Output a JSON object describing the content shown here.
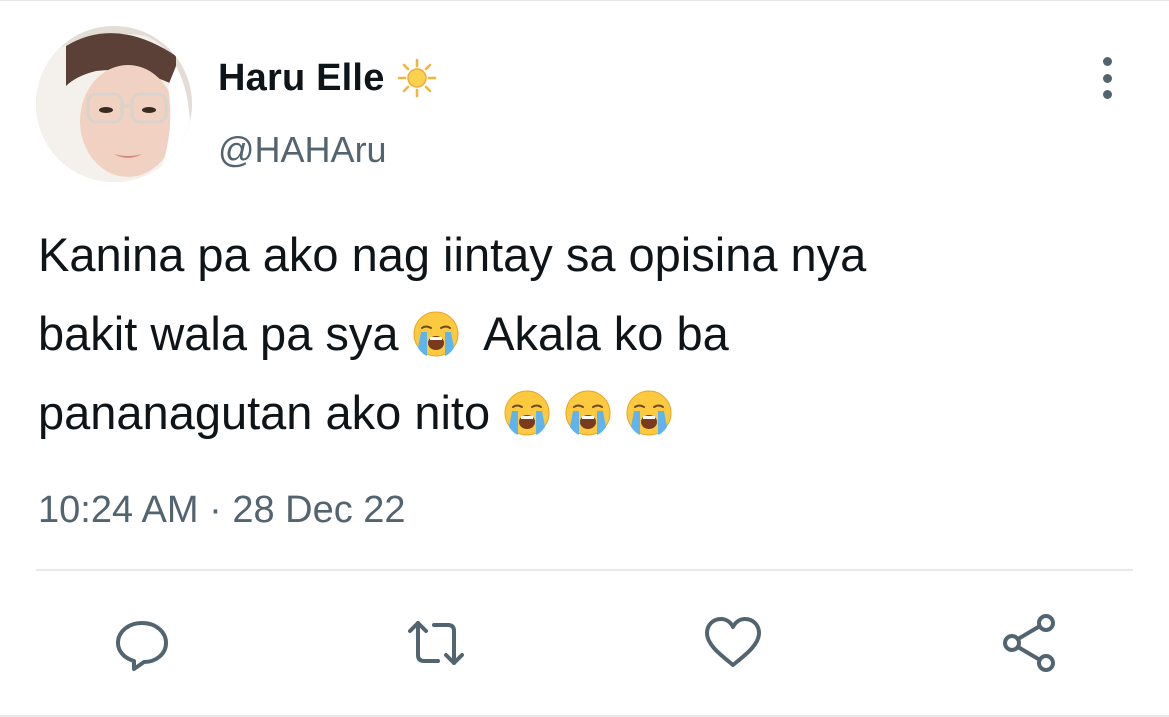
{
  "tweet": {
    "author": {
      "display_name": "Haru Elle",
      "badge_icon": "sun-icon",
      "handle": "@HAHAru",
      "avatar_icon": "profile-photo"
    },
    "text_lines": [
      "Kanina pa ako nag iintay sa opisina nya",
      "bakit wala pa sya",
      "Akala ko ba",
      "pananagutan ako nito"
    ],
    "emoji_icon": "loudly-crying-face-emoji",
    "timestamp": "10:24 AM · 28 Dec 22",
    "more_icon": "vertical-ellipsis-icon"
  },
  "actions": [
    {
      "name": "reply",
      "icon": "reply-icon"
    },
    {
      "name": "retweet",
      "icon": "retweet-icon"
    },
    {
      "name": "like",
      "icon": "heart-icon"
    },
    {
      "name": "share",
      "icon": "share-icon"
    }
  ],
  "colors": {
    "text_primary": "#0f1419",
    "text_secondary": "#536471",
    "divider": "#e7e9ea",
    "icon": "#536471"
  }
}
